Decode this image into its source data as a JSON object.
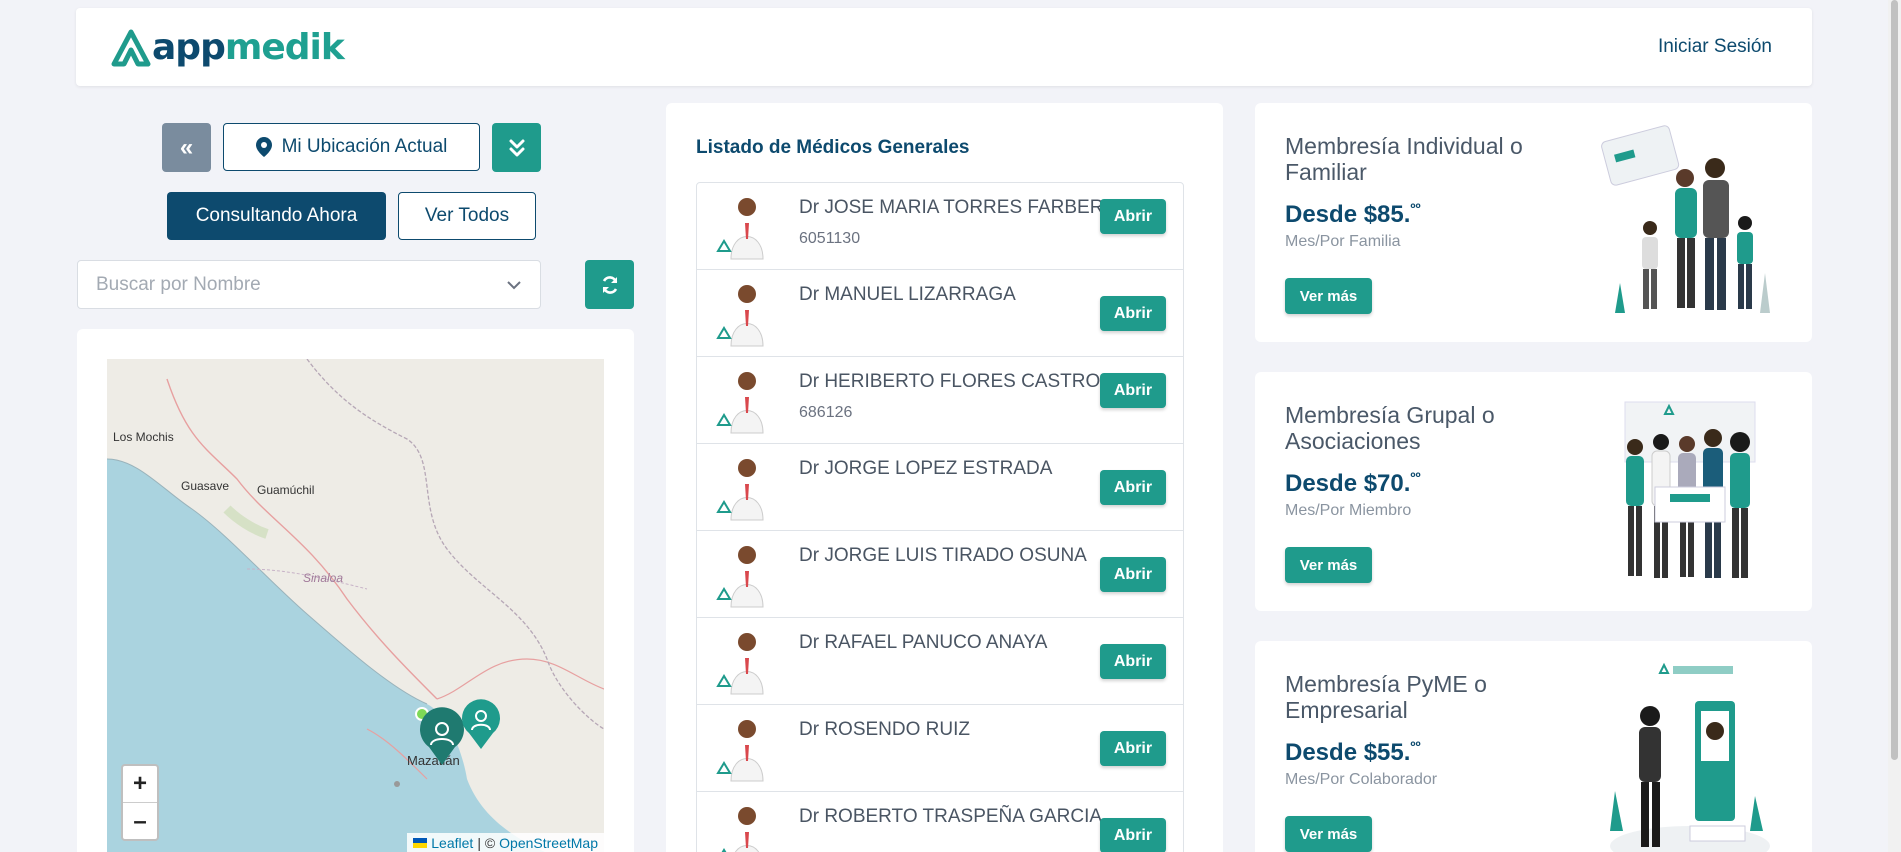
{
  "header": {
    "logo_part1": "app",
    "logo_part2": "medik",
    "login_label": "Iniciar Sesión"
  },
  "controls": {
    "location_label": "Mi Ubicación Actual",
    "now_label": "Consultando Ahora",
    "all_label": "Ver Todos",
    "search_placeholder": "Buscar por Nombre"
  },
  "map": {
    "labels": [
      "Los Mochis",
      "Guasave",
      "Guamúchil",
      "Sinaloa",
      "Mazatlán"
    ],
    "zoom_in": "+",
    "zoom_out": "–",
    "attribution_leaflet": "Leaflet",
    "attribution_sep": "| ©",
    "attribution_osm": "OpenStreetMap"
  },
  "doctors": {
    "title": "Listado de Médicos Generales",
    "open_label": "Abrir",
    "items": [
      {
        "name": "Dr JOSE MARIA TORRES FARBER",
        "sub": "6051130"
      },
      {
        "name": "Dr MANUEL LIZARRAGA",
        "sub": ""
      },
      {
        "name": "Dr HERIBERTO FLORES CASTRO",
        "sub": "686126"
      },
      {
        "name": "Dr JORGE LOPEZ ESTRADA",
        "sub": ""
      },
      {
        "name": "Dr JORGE LUIS TIRADO OSUNA",
        "sub": ""
      },
      {
        "name": "Dr RAFAEL PANUCO ANAYA",
        "sub": ""
      },
      {
        "name": "Dr ROSENDO RUIZ",
        "sub": ""
      },
      {
        "name": "Dr ROBERTO TRASPEÑA GARCIA",
        "sub": ""
      }
    ]
  },
  "memberships": [
    {
      "title": "Membresía Individual o Familiar",
      "price": "Desde $85.",
      "cents": "ºº",
      "unit": "Mes/Por Familia",
      "cta": "Ver más"
    },
    {
      "title": "Membresía Grupal o Asociaciones",
      "price": "Desde $70.",
      "cents": "ºº",
      "unit": "Mes/Por Miembro",
      "cta": "Ver más"
    },
    {
      "title": "Membresía PyME o Empresarial",
      "price": "Desde $55.",
      "cents": "ºº",
      "unit": "Mes/Por Colaborador",
      "cta": "Ver más"
    }
  ],
  "colors": {
    "primary": "#0d4a6e",
    "accent": "#1f9b8c",
    "background": "#f2f3f8"
  }
}
